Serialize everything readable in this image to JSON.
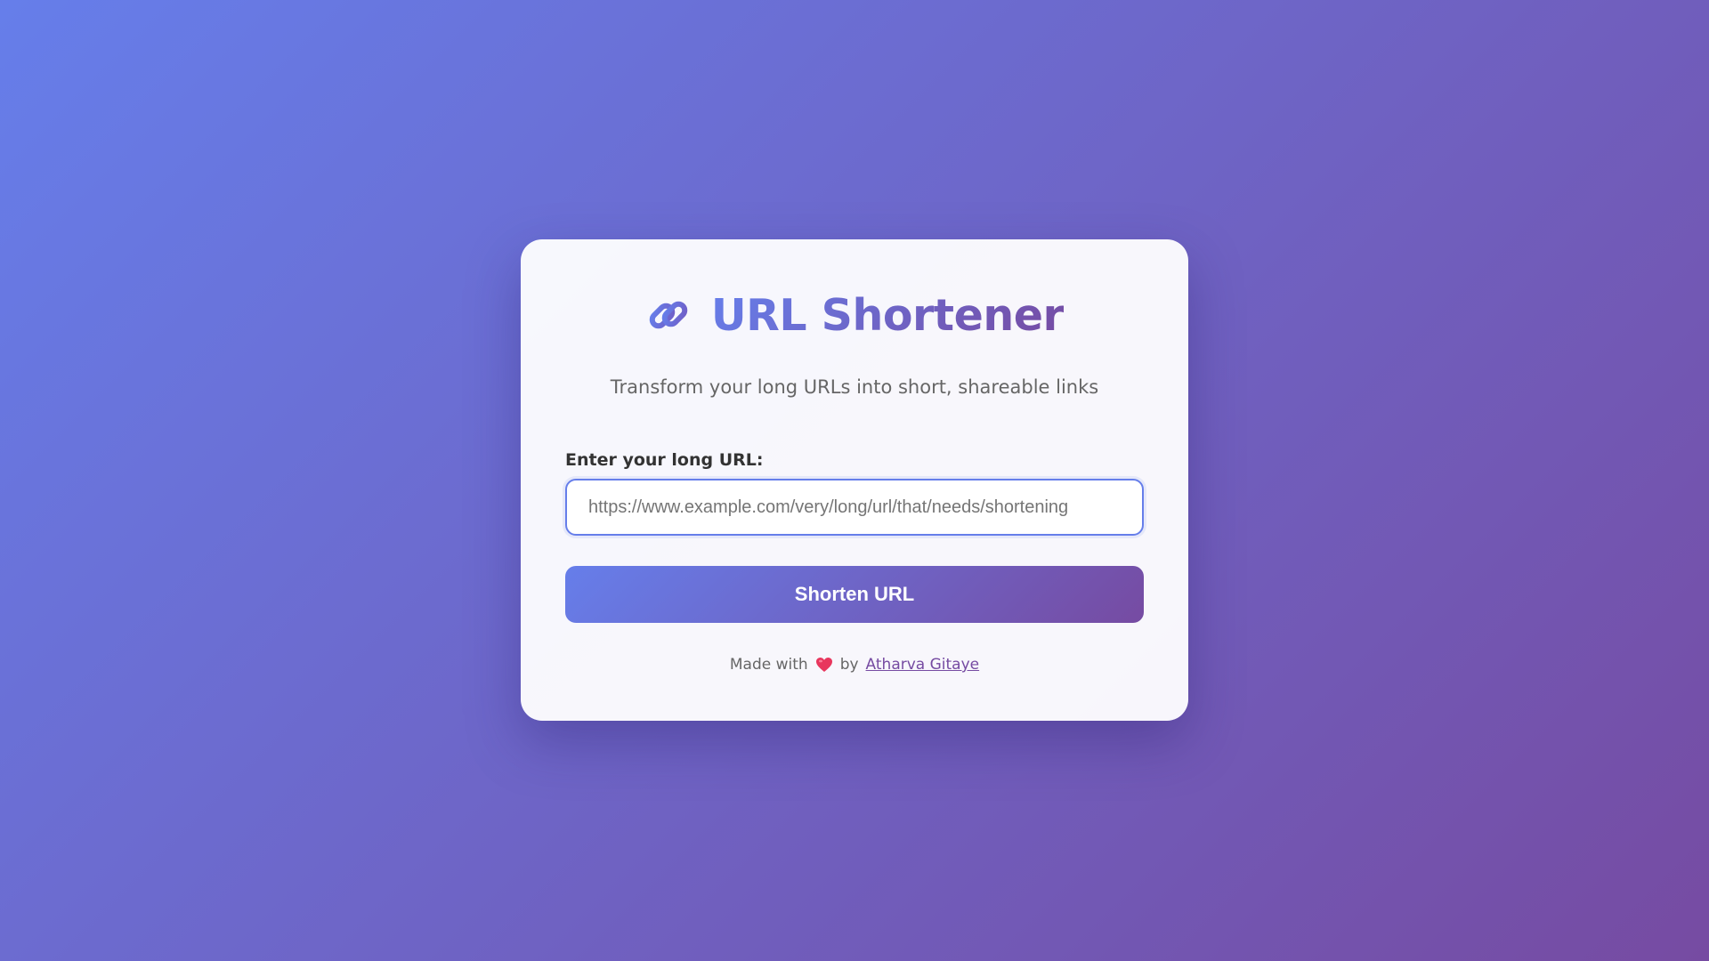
{
  "header": {
    "title": "URL Shortener",
    "icon": "link-icon",
    "subtitle": "Transform your long URLs into short, shareable links"
  },
  "form": {
    "label": "Enter your long URL:",
    "input_value": "",
    "placeholder": "https://www.example.com/very/long/url/that/needs/shortening",
    "button_label": "Shorten URL"
  },
  "footer": {
    "made_with": "Made with",
    "heart_icon": "heart-icon",
    "by": "by",
    "author": "Atharva Gitaye"
  },
  "colors": {
    "gradient_start": "#667eea",
    "gradient_end": "#764ba2",
    "card_background": "#f8f7fc",
    "heart": "#e8365d"
  }
}
